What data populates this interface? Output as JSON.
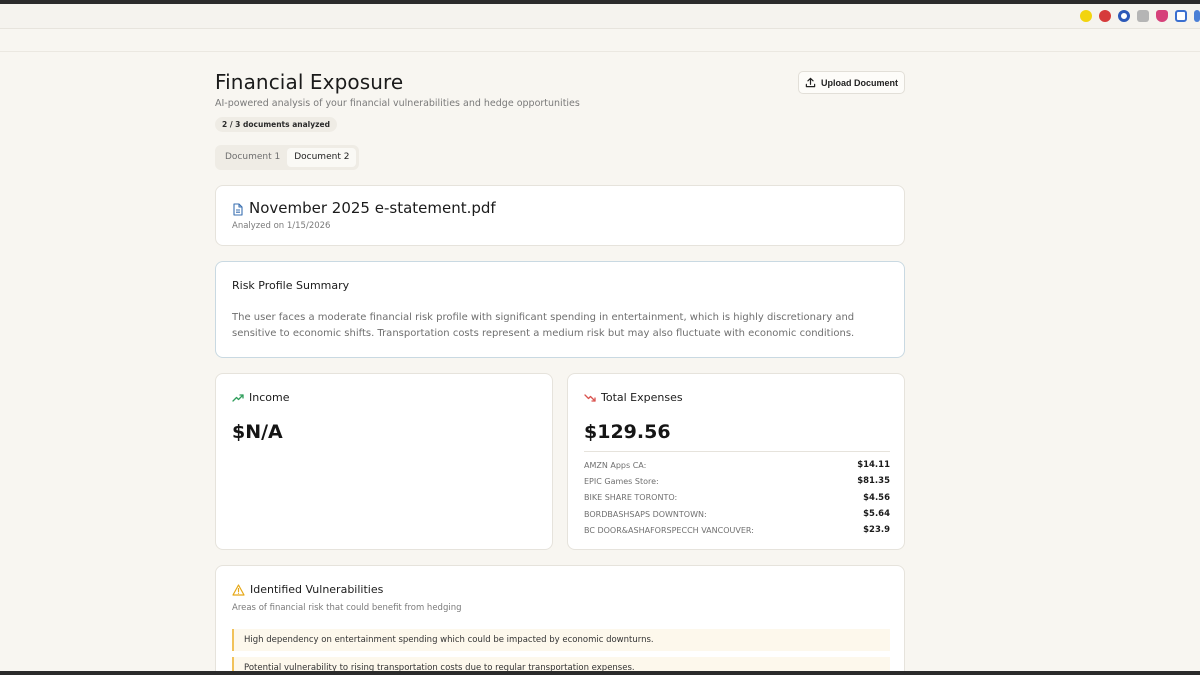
{
  "header": {
    "title": "Financial Exposure",
    "subtitle": "AI-powered analysis of your financial vulnerabilities and hedge opportunities",
    "badge": "2 / 3 documents analyzed",
    "upload_label": "Upload Document"
  },
  "tabs": [
    {
      "label": "Document 1",
      "active": false
    },
    {
      "label": "Document 2",
      "active": true
    }
  ],
  "document": {
    "name": "November 2025 e-statement.pdf",
    "analyzed": "Analyzed on 1/15/2026"
  },
  "risk": {
    "title": "Risk Profile Summary",
    "text": "The user faces a moderate financial risk profile with significant spending in entertainment, which is highly discretionary and sensitive to economic shifts. Transportation costs represent a medium risk but may also fluctuate with economic conditions."
  },
  "income": {
    "label": "Income",
    "value": "$N/A"
  },
  "expenses": {
    "label": "Total Expenses",
    "value": "$129.56",
    "items": [
      {
        "name": "AMZN Apps CA:",
        "amount": "$14.11"
      },
      {
        "name": "EPIC Games Store:",
        "amount": "$81.35"
      },
      {
        "name": "BIKE SHARE TORONTO:",
        "amount": "$4.56"
      },
      {
        "name": "BORDBASHSAPS DOWNTOWN:",
        "amount": "$5.64"
      },
      {
        "name": "BC DOOR&ASHAFORSPECCH VANCOUVER:",
        "amount": "$23.9"
      }
    ]
  },
  "vulnerabilities": {
    "title": "Identified Vulnerabilities",
    "subtitle": "Areas of financial risk that could benefit from hedging",
    "items": [
      "High dependency on entertainment spending which could be impacted by economic downturns.",
      "Potential vulnerability to rising transportation costs due to regular transportation expenses."
    ]
  },
  "colors": {
    "income_trend": "#2f9e5b",
    "expense_trend": "#d9534f",
    "warning": "#e6a817",
    "doc_icon": "#3a6fb0"
  }
}
